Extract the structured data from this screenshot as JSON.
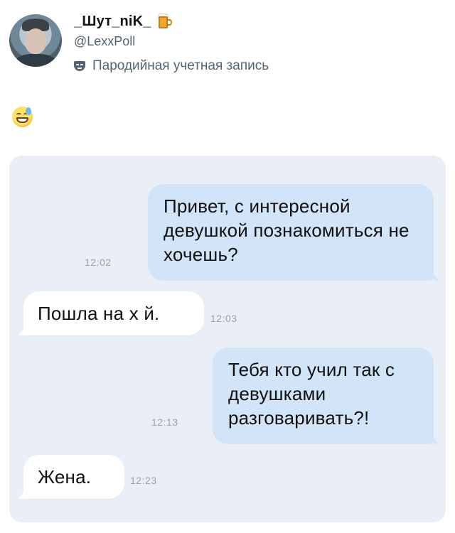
{
  "profile": {
    "display_name": "_Шут_niK_",
    "name_emoji_icon": "beer-mug-icon",
    "handle": "@LexxPoll",
    "parody_label": "Пародийная учетная запись",
    "parody_icon": "mask-icon"
  },
  "post": {
    "emoji_icon": "sweat-smile-emoji"
  },
  "chat": {
    "background": "#eaeef6",
    "outgoing_color": "#d2e4f7",
    "incoming_color": "#ffffff",
    "messages": [
      {
        "direction": "out",
        "text": "Привет, с интересной девушкой познакомиться не хочешь?",
        "time": "12:02"
      },
      {
        "direction": "in",
        "text": "Пошла на х  й.",
        "time": "12:03"
      },
      {
        "direction": "out",
        "text": "Тебя кто учил так с девушками разговаривать?!",
        "time": "12:13"
      },
      {
        "direction": "in",
        "text": "Жена.",
        "time": "12:23"
      }
    ]
  }
}
